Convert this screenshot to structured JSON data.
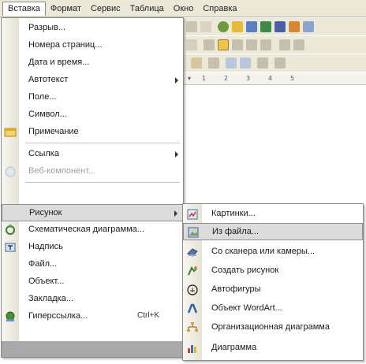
{
  "menubar": {
    "items": [
      {
        "label": "Вставка",
        "active": true
      },
      {
        "label": "Формат",
        "active": false
      },
      {
        "label": "Сервис",
        "active": false
      },
      {
        "label": "Таблица",
        "active": false
      },
      {
        "label": "Окно",
        "active": false
      },
      {
        "label": "Справка",
        "active": false
      }
    ]
  },
  "insert_menu": {
    "items": [
      {
        "label": "Разрыв...",
        "icon": "none"
      },
      {
        "label": "Номера страниц...",
        "icon": "none"
      },
      {
        "label": "Дата и время...",
        "icon": "none"
      },
      {
        "label": "Автотекст",
        "icon": "none",
        "submenu": true
      },
      {
        "label": "Поле...",
        "icon": "none"
      },
      {
        "label": "Символ...",
        "icon": "none"
      },
      {
        "label": "Примечание",
        "icon": "comment-note-icon"
      },
      {
        "label": "Ссылка",
        "icon": "none",
        "submenu": true
      },
      {
        "label": "Веб-компонент...",
        "icon": "web-component-icon",
        "disabled": true
      },
      {
        "label": "Рисунок",
        "icon": "none",
        "submenu": true,
        "highlight": true
      },
      {
        "label": "Схематическая диаграмма...",
        "icon": "diagram-icon"
      },
      {
        "label": "Надпись",
        "icon": "text-box-icon"
      },
      {
        "label": "Файл...",
        "icon": "none"
      },
      {
        "label": "Объект...",
        "icon": "none"
      },
      {
        "label": "Закладка...",
        "icon": "none"
      },
      {
        "label": "Гиперссылка...",
        "icon": "hyperlink-icon",
        "shortcut": "Ctrl+K"
      }
    ]
  },
  "picture_submenu": {
    "items": [
      {
        "label": "Картинки...",
        "icon": "clip-art-icon"
      },
      {
        "label": "Из файла...",
        "icon": "from-file-icon",
        "highlight": true
      },
      {
        "label": "Со сканера или камеры...",
        "icon": "scanner-icon"
      },
      {
        "label": "Создать рисунок",
        "icon": "new-drawing-icon"
      },
      {
        "label": "Автофигуры",
        "icon": "autoshapes-icon"
      },
      {
        "label": "Объект WordArt...",
        "icon": "wordart-icon"
      },
      {
        "label": "Организационная диаграмма",
        "icon": "org-chart-icon"
      },
      {
        "label": "Диаграмма",
        "icon": "chart-icon"
      }
    ]
  },
  "ruler": {
    "ticks": [
      "1",
      "2",
      "3",
      "4",
      "5"
    ]
  },
  "colors": {
    "menu_bg": "#ece9d8",
    "highlight": "#dcdcdc",
    "border": "#8a8a8a"
  }
}
